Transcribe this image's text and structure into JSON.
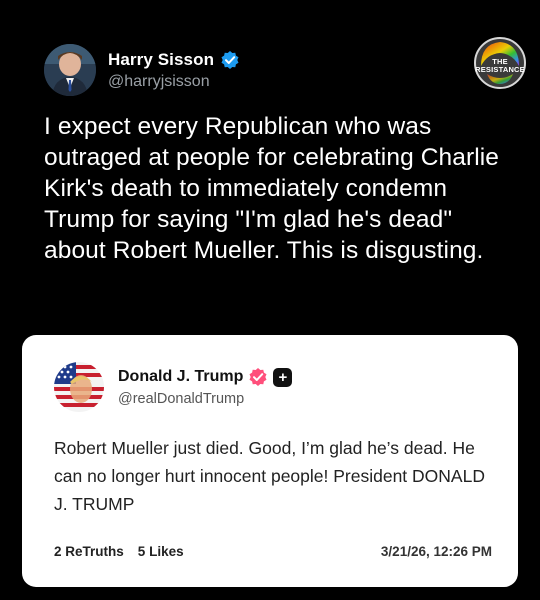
{
  "post": {
    "author_name": "Harry Sisson",
    "author_handle": "@harryjsisson",
    "text": "I expect every Republican who was outraged at people for celebrating Charlie Kirk's death to immediately condemn Trump for saying \"I'm glad he's dead\" about Robert Mueller. This is disgusting.",
    "verified_icon": "verified-badge-icon",
    "accent_color": "#1d9bf0"
  },
  "watermark": {
    "line1": "THE",
    "line2": "RESISTANCE"
  },
  "quoted_post": {
    "author_name": "Donald J. Trump",
    "author_handle": "@realDonaldTrump",
    "text": "Robert Mueller just died. Good, I’m glad he’s dead. He can no longer hurt innocent people! President DONALD J. TRUMP",
    "retruths_count": "2",
    "retruths_label": "ReTruths",
    "likes_count": "5",
    "likes_label": "Likes",
    "timestamp": "3/21/26, 12:26 PM",
    "badge_color": "#ff4f7b"
  }
}
